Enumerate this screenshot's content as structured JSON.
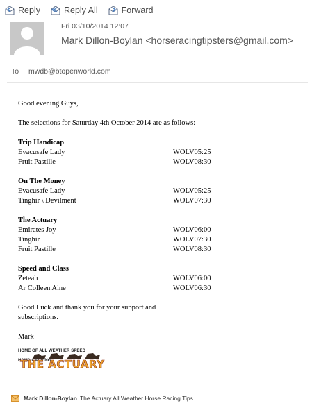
{
  "toolbar": {
    "reply": "Reply",
    "reply_all": "Reply All",
    "forward": "Forward"
  },
  "header": {
    "date": "Fri 03/10/2014 12:07",
    "sender": "Mark Dillon-Boylan <horseracingtipsters@gmail.com>",
    "to_label": "To",
    "to_value": "mwdb@btopenworld.com"
  },
  "body": {
    "greeting": "Good evening Guys,",
    "intro": "The selections for Saturday 4th October 2014 are as follows:",
    "sections": [
      {
        "title": "Trip Handicap",
        "rows": [
          {
            "horse": "Evacusafe Lady",
            "race": "WOLV05:25"
          },
          {
            "horse": "Fruit Pastille",
            "race": "WOLV08:30"
          }
        ]
      },
      {
        "title": "On The Money",
        "rows": [
          {
            "horse": "Evacusafe Lady",
            "race": "WOLV05:25"
          },
          {
            "horse": "Tinghir \\ Devilment",
            "race": "WOLV07:30"
          }
        ]
      },
      {
        "title": "The Actuary",
        "rows": [
          {
            "horse": "Emirates Joy",
            "race": "WOLV06:00"
          },
          {
            "horse": "Tinghir",
            "race": "WOLV07:30"
          },
          {
            "horse": "Fruit Pastille",
            "race": "WOLV08:30"
          }
        ]
      },
      {
        "title": "Speed and Class",
        "rows": [
          {
            "horse": "Zeteah",
            "race": "WOLV06:00"
          },
          {
            "horse": "Ar Colleen Aine",
            "race": "WOLV06:30"
          }
        ]
      }
    ],
    "closing_1": "Good Luck and thank you for your support and",
    "closing_2": "subscriptions.",
    "signoff": "Mark",
    "logo_top": "HOME OF ALL WEATHER SPEED HANDICAPPING",
    "logo_main": "THE ACTUARY"
  },
  "footer": {
    "name": "Mark Dillon-Boylan",
    "signature": "The Actuary All Weather Horse Racing Tips",
    "icon": "envelope-icon"
  },
  "colors": {
    "icon_blue": "#5a7fb5",
    "envelope": "#e8a33c",
    "logo_orange": "#f0a830"
  }
}
